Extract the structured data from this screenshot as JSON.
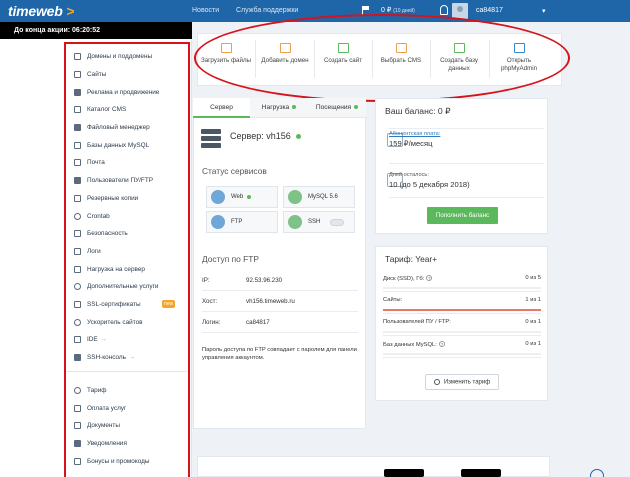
{
  "header": {
    "logo_text": "timeweb",
    "logo_mark": ">",
    "nav_news": "Новости",
    "nav_support": "Служба поддержки",
    "balance": "0 ₽",
    "balance_days": "(10 дней)",
    "username": "ca84817",
    "caret": "▾"
  },
  "promo": {
    "label": "До конца акции:",
    "time": "06:20:52"
  },
  "sidebar": {
    "items": [
      {
        "label": "Домены и поддомены"
      },
      {
        "label": "Сайты"
      },
      {
        "label": "Реклама и продвижение"
      },
      {
        "label": "Каталог CMS"
      },
      {
        "label": "Файловый менеджер"
      },
      {
        "label": "Базы данных MySQL"
      },
      {
        "label": "Почта"
      },
      {
        "label": "Пользователи ПУ/FTP"
      },
      {
        "label": "Резервные копии"
      },
      {
        "label": "Crontab"
      },
      {
        "label": "Безопасность"
      },
      {
        "label": "Логи"
      },
      {
        "label": "Нагрузка на сервер"
      },
      {
        "label": "Дополнительные услуги"
      },
      {
        "label": "SSL-сертификаты",
        "badge": "new"
      },
      {
        "label": "Ускоритель сайтов"
      },
      {
        "label": "IDE",
        "arrow": "→"
      },
      {
        "label": "SSH-консоль",
        "arrow": "→"
      }
    ],
    "items2": [
      {
        "label": "Тариф"
      },
      {
        "label": "Оплата услуг"
      },
      {
        "label": "Документы"
      },
      {
        "label": "Уведомления"
      },
      {
        "label": "Бонусы и промокоды"
      }
    ]
  },
  "quick_actions": [
    {
      "label": "Загрузить файлы",
      "icon": "folder-upload-icon"
    },
    {
      "label": "Добавить домен",
      "icon": "add-domain-icon"
    },
    {
      "label": "Создать сайт",
      "icon": "new-site-icon"
    },
    {
      "label": "Выбрать CMS",
      "icon": "cms-box-icon"
    },
    {
      "label": "Создать базу данных",
      "icon": "database-add-icon"
    },
    {
      "label": "Открыть phpMyAdmin",
      "icon": "phpmyadmin-icon"
    }
  ],
  "server": {
    "tabs": [
      "Сервер",
      "Нагрузка",
      "Посещения"
    ],
    "name": "Сервер: vh156",
    "services_title": "Статус сервисов",
    "services": [
      {
        "label": "Web"
      },
      {
        "label": "MySQL 5.6"
      },
      {
        "label": "FTP"
      },
      {
        "label": "SSH"
      }
    ],
    "ftp_title": "Доступ по FTP",
    "ftp": [
      {
        "key": "IP:",
        "value": "92.53.96.230"
      },
      {
        "key": "Хост:",
        "value": "vh156.timeweb.ru"
      },
      {
        "key": "Логин:",
        "value": "ca84817"
      }
    ],
    "ftp_note": "Пароль доступа по FTP совпадает с паролем для панели управления аккаунтом."
  },
  "balance": {
    "title": "Ваш баланс: 0 ₽",
    "fee_label": "Абонентская плата:",
    "fee_value": "159 ₽/месяц",
    "days_label": "Дней осталось:",
    "days_value": "10 (до 5 декабря 2018)",
    "pay_button": "Пополнить баланс"
  },
  "tariff": {
    "title": "Тариф: Year+",
    "rows": [
      {
        "label": "Диск (SSD), Гб:",
        "value": "0 из 5",
        "help": "?",
        "fill": 0
      },
      {
        "label": "Сайты:",
        "value": "1 из 1",
        "fill": 1
      },
      {
        "label": "Пользователей ПУ / FTP:",
        "value": "0 из 1",
        "fill": 0
      },
      {
        "label": "Баз данных MySQL:",
        "value": "0 из 1",
        "help": "?",
        "fill": 0
      }
    ],
    "change_button": "Изменить тариф"
  },
  "colors": {
    "header": "#1f66a8",
    "accent_green": "#5cb85c",
    "annotation_red": "#d6121b"
  }
}
